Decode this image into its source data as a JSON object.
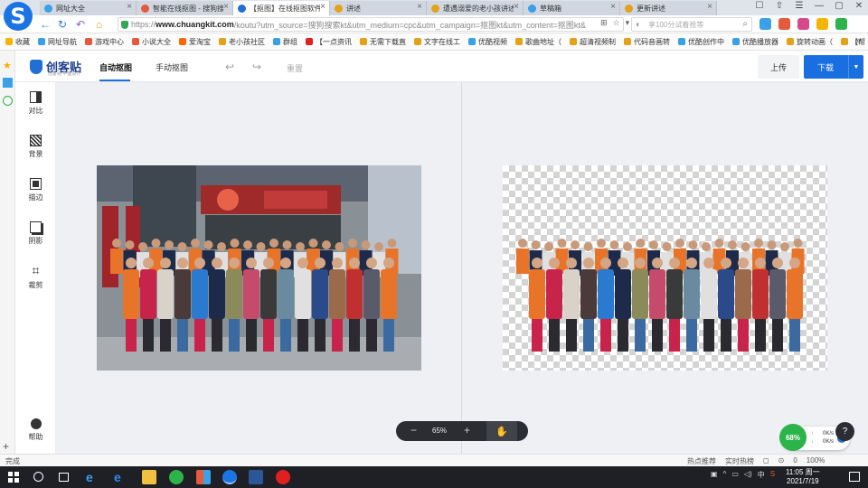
{
  "browser": {
    "logo_letter": "S",
    "tabs": [
      {
        "title": "网址大全",
        "active": false,
        "color": "#3aa0e8"
      },
      {
        "title": "智能在线抠图 - 搜狗搜索",
        "active": false,
        "color": "#e55a3c"
      },
      {
        "title": "【抠图】在线抠图软件",
        "active": true,
        "color": "#1f6fd6"
      },
      {
        "title": "讲述",
        "active": false,
        "color": "#e3a21a"
      },
      {
        "title": "遭遇溺爱的老小孩讲述",
        "active": false,
        "color": "#e3a21a"
      },
      {
        "title": "草稿箱",
        "active": false,
        "color": "#3aa0e8"
      },
      {
        "title": "更新讲述",
        "active": false,
        "color": "#e3a21a"
      }
    ],
    "window_controls": [
      "☐",
      "⇧",
      "☰",
      "—",
      "▢",
      "✕"
    ],
    "url": {
      "scheme": "https://",
      "domain": "www.chuangkit.com",
      "rest": "/koutu?utm_source=搜狗搜索kt&utm_medium=cpc&utm_campaign=抠图kt&utm_content=抠图kt&"
    },
    "search_placeholder": "享100分试着抢等",
    "bookmarks": [
      {
        "label": "收藏",
        "color": "#f5b400"
      },
      {
        "label": "网址导航",
        "color": "#3aa0e8"
      },
      {
        "label": "游戏中心",
        "color": "#e55a3c"
      },
      {
        "label": "小说大全",
        "color": "#e55a3c"
      },
      {
        "label": "爱淘宝",
        "color": "#ff6a00"
      },
      {
        "label": "老小孩社区",
        "color": "#e3a21a"
      },
      {
        "label": "群组",
        "color": "#3aa0e8"
      },
      {
        "label": "【一点资讯",
        "color": "#e02020"
      },
      {
        "label": "无需下载直",
        "color": "#e3a21a"
      },
      {
        "label": "文字在线工",
        "color": "#e3a21a"
      },
      {
        "label": "优酷视频",
        "color": "#3aa0e8"
      },
      {
        "label": "歌曲地址（",
        "color": "#e3a21a"
      },
      {
        "label": "超清视频制",
        "color": "#e3a21a"
      },
      {
        "label": "代码音画转",
        "color": "#e3a21a"
      },
      {
        "label": "优酷创作中",
        "color": "#3aa0e8"
      },
      {
        "label": "优酷播放器",
        "color": "#3aa0e8"
      },
      {
        "label": "旋转动画（",
        "color": "#e3a21a"
      },
      {
        "label": "【帮",
        "color": "#e3a21a"
      }
    ],
    "bookmarks_more": "»"
  },
  "app": {
    "brand_name": "创客贴",
    "brand_sub": "创客贴 平面设计",
    "modes": [
      "自动抠图",
      "手动抠图"
    ],
    "reset_label": "重置",
    "upload_label": "上传",
    "download_label": "下载",
    "tools": [
      "对比",
      "背景",
      "描边",
      "阴影",
      "裁剪"
    ],
    "help_label": "帮助",
    "zoom": {
      "value": "65%",
      "minus": "−",
      "plus": "+"
    },
    "speed_widget": {
      "percent": "68%",
      "up": "0K/s",
      "down": "0K/s"
    },
    "accent_color": "#1a6fe0"
  },
  "status_bar": {
    "left": "完成",
    "items": [
      "热点推荐",
      "实时热榜",
      "◻",
      "⊙",
      "0",
      "100%"
    ]
  },
  "taskbar": {
    "time": "11:05 周一",
    "date": "2021/7/19"
  }
}
